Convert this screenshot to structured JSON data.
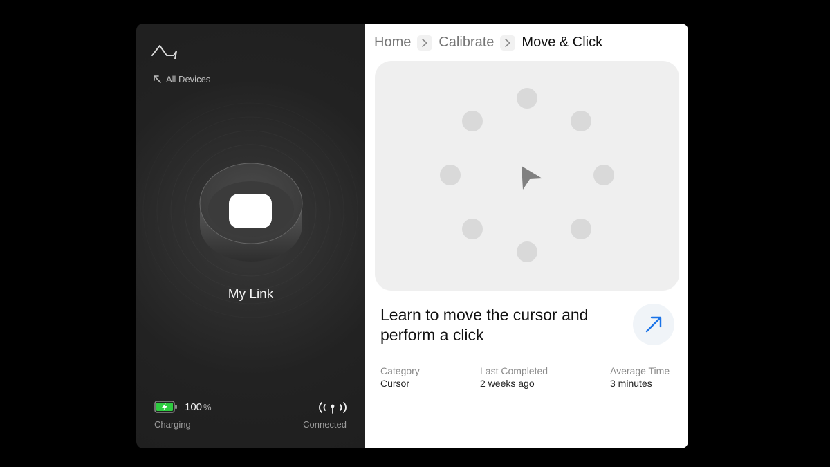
{
  "sidebar": {
    "back_link": "All Devices",
    "device_name": "My Link",
    "battery": {
      "percent": "100",
      "unit": "%",
      "status": "Charging",
      "color": "#2ecc40"
    },
    "connection": {
      "status": "Connected"
    }
  },
  "breadcrumb": {
    "items": [
      "Home",
      "Calibrate",
      "Move & Click"
    ]
  },
  "lesson": {
    "title": "Learn to move the cursor and perform a click",
    "meta": {
      "category_label": "Category",
      "category_value": "Cursor",
      "last_label": "Last Completed",
      "last_value": "2 weeks ago",
      "avg_label": "Average Time",
      "avg_value": "3 minutes"
    },
    "accent_color": "#1a73e8"
  },
  "icons": {
    "logo": "waveform-logo-icon",
    "back": "arrow-up-left-icon",
    "separator": "chevron-right-icon",
    "cursor": "cursor-arrow-icon",
    "open": "arrow-up-right-icon",
    "battery": "battery-charging-icon",
    "signal": "broadcast-signal-icon"
  }
}
